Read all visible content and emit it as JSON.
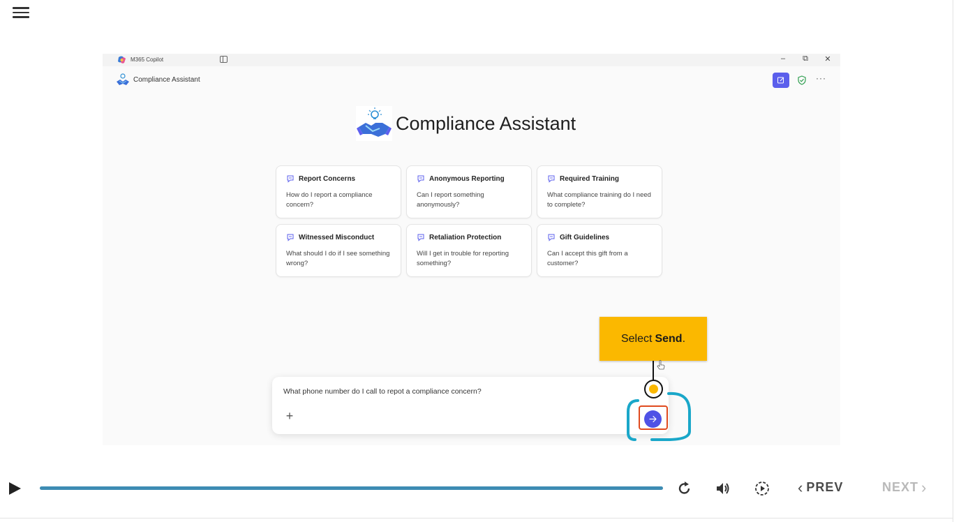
{
  "window": {
    "app_title": "M365 Copilot",
    "controls": {
      "minimize": "–",
      "restore": "⧉",
      "close": "✕"
    }
  },
  "header": {
    "agent_name": "Compliance Assistant",
    "more": "···"
  },
  "hero": {
    "title": "Compliance Assistant"
  },
  "prompt_cards": [
    {
      "title": "Report Concerns",
      "text": "How do I report a compliance concern?"
    },
    {
      "title": "Anonymous Reporting",
      "text": "Can I report something anonymously?"
    },
    {
      "title": "Required Training",
      "text": "What compliance training do I need to complete?"
    },
    {
      "title": "Witnessed Misconduct",
      "text": "What should I do if I see something wrong?"
    },
    {
      "title": "Retaliation Protection",
      "text": "Will I get in trouble for reporting something?"
    },
    {
      "title": "Gift Guidelines",
      "text": "Can I accept this gift from a customer?"
    }
  ],
  "composer": {
    "text": "What phone number do I call to repot a compliance concern?",
    "plus": "+"
  },
  "callout": {
    "prefix": "Select",
    "bold": "Send",
    "suffix": "."
  },
  "player": {
    "progress_fraction": 1.0,
    "prev_label": "PREV",
    "next_label": "NEXT",
    "prev_chevron": "‹",
    "next_chevron": "›"
  },
  "colors": {
    "accent": "#4f52e6",
    "callout": "#fbb800",
    "highlight_red": "#e04a1f",
    "highlight_cyan": "#1aa7c9",
    "progress": "#3d8cb3"
  }
}
